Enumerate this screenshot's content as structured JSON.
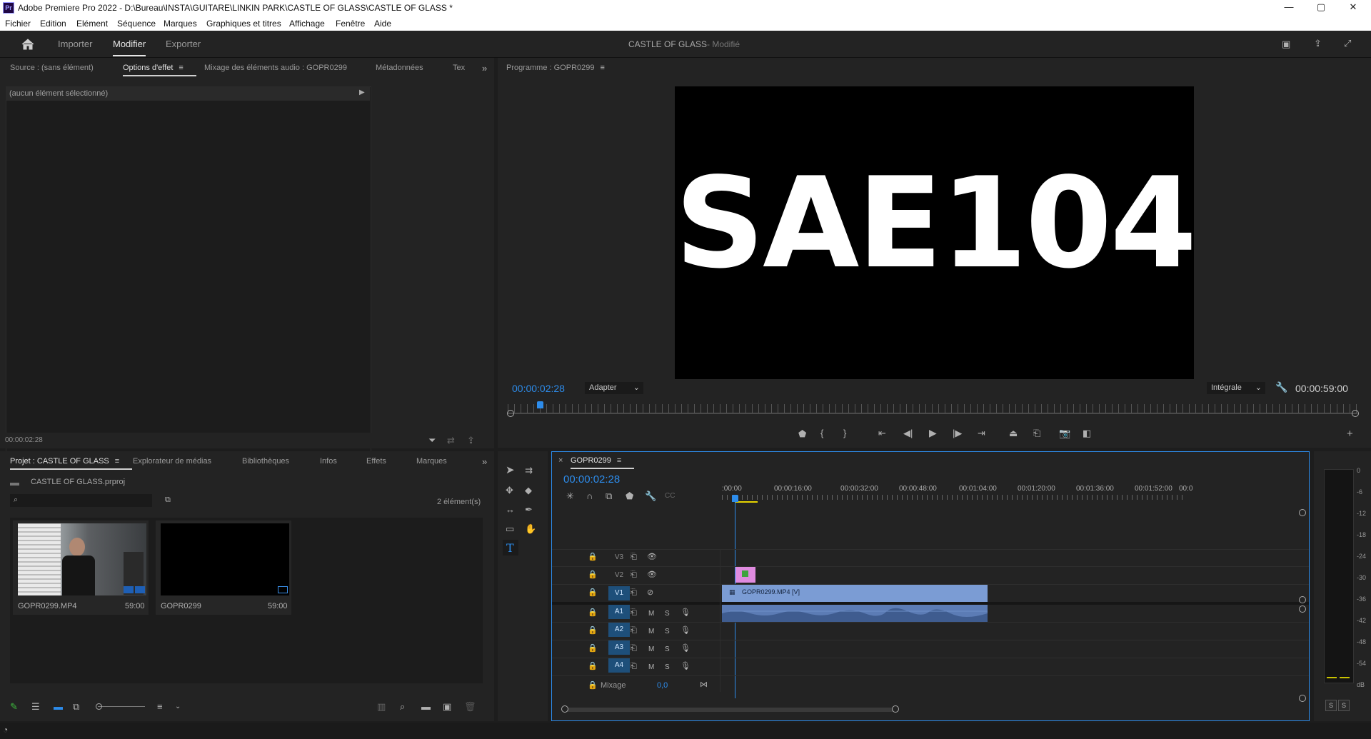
{
  "window": {
    "app_icon": "Pr",
    "title": "Adobe Premiere Pro 2022 - D:\\Bureau\\INSTA\\GUITARE\\LINKIN PARK\\CASTLE OF GLASS\\CASTLE OF GLASS *",
    "controls": {
      "minimize": "—",
      "maximize": "▢",
      "close": "✕"
    }
  },
  "menu": [
    "Fichier",
    "Edition",
    "Elément",
    "Séquence",
    "Marques",
    "Graphiques et titres",
    "Affichage",
    "Fenêtre",
    "Aide"
  ],
  "header": {
    "tabs": [
      "Importer",
      "Modifier",
      "Exporter"
    ],
    "active_tab": "Modifier",
    "project_title": "CASTLE OF GLASS",
    "project_status": "- Modifié"
  },
  "source_panel": {
    "tabs": [
      "Source : (sans élément)",
      "Options d'effet",
      "Mixage des éléments audio : GOPR0299",
      "Métadonnées",
      "Tex"
    ],
    "active_tab": "Options d'effet",
    "no_selection": "(aucun élément sélectionné)",
    "timecode": "00:00:02:28"
  },
  "program_monitor": {
    "title": "Programme : GOPR0299",
    "video_text": "SAE104",
    "timecode": "00:00:02:28",
    "fit_select": "Adapter",
    "quality_select": "Intégrale",
    "duration": "00:00:59:00"
  },
  "project_panel": {
    "tabs": [
      "Projet : CASTLE OF GLASS",
      "Explorateur de médias",
      "Bibliothèques",
      "Infos",
      "Effets",
      "Marques"
    ],
    "active_tab": "Projet : CASTLE OF GLASS",
    "file": "CASTLE OF GLASS.prproj",
    "count": "2 élément(s)",
    "items": [
      {
        "name": "GOPR0299.MP4",
        "duration": "59:00"
      },
      {
        "name": "GOPR0299",
        "duration": "59:00"
      }
    ]
  },
  "timeline": {
    "sequence": "GOPR0299",
    "timecode": "00:00:02:28",
    "ruler": [
      ":00:00",
      "00:00:16:00",
      "00:00:32:00",
      "00:00:48:00",
      "00:01:04:00",
      "00:01:20:00",
      "00:01:36:00",
      "00:01:52:00",
      "00:0"
    ],
    "video_tracks": [
      "V3",
      "V2",
      "V1"
    ],
    "audio_tracks": [
      "A1",
      "A2",
      "A3",
      "A4"
    ],
    "mix_label": "Mixage",
    "mix_value": "0,0",
    "clip_label": "GOPR0299.MP4 [V]",
    "mute": "M",
    "solo": "S"
  },
  "vu_meter": {
    "scale": [
      "0",
      "-6",
      "-12",
      "-18",
      "-24",
      "-30",
      "-36",
      "-42",
      "-48",
      "-54",
      "dB"
    ],
    "buttons": [
      "S",
      "S"
    ]
  },
  "colors": {
    "accent": "#2d8ceb",
    "clip_video": "#7b9cd4",
    "clip_audio": "#5c7cb5",
    "graphic_clip": "#e08be0",
    "active_track": "#1e4f7a",
    "panel": "#232323"
  }
}
